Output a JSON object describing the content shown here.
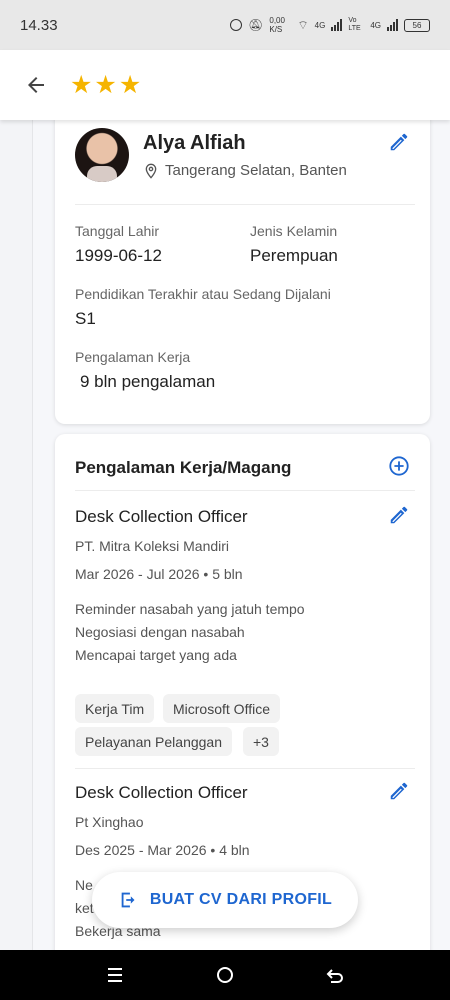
{
  "status_bar": {
    "time": "14.33",
    "net_speed": "0,00 K/S",
    "net1": "4G",
    "net2": "Vo LTE",
    "net3": "4G",
    "battery": "56"
  },
  "app_bar": {
    "stars": [
      "★",
      "★",
      "★"
    ]
  },
  "profile": {
    "name": "Alya Alfiah",
    "location": "Tangerang Selatan, Banten",
    "birth_label": "Tanggal Lahir",
    "birth_value": "1999-06-12",
    "gender_label": "Jenis Kelamin",
    "gender_value": "Perempuan",
    "education_label": "Pendidikan Terakhir atau Sedang Dijalani",
    "education_value": "S1",
    "experience_label": "Pengalaman Kerja",
    "experience_value": "9 bln pengalaman"
  },
  "experience_section": {
    "title": "Pengalaman Kerja/Magang",
    "jobs": [
      {
        "title": "Desk Collection Officer",
        "company": "PT. Mitra Koleksi Mandiri",
        "period": "Mar 2026 - Jul 2026 • 5 bln",
        "desc": [
          "Reminder nasabah yang jatuh tempo",
          "Negosiasi dengan nasabah",
          "Mencapai target yang ada"
        ],
        "skills": [
          "Kerja Tim",
          "Microsoft Office",
          "Pelayanan Pelanggan",
          "+3"
        ]
      },
      {
        "title": "Desk Collection Officer",
        "company": "Pt Xinghao",
        "period": "Des 2025 - Mar 2026 • 4 bln",
        "desc": [
          "Ne",
          "ket",
          "Bekerja sama"
        ]
      }
    ]
  },
  "fab": {
    "label": "BUAT CV DARI PROFIL"
  },
  "colors": {
    "accent": "#1e66d0",
    "star": "#f5b400"
  }
}
